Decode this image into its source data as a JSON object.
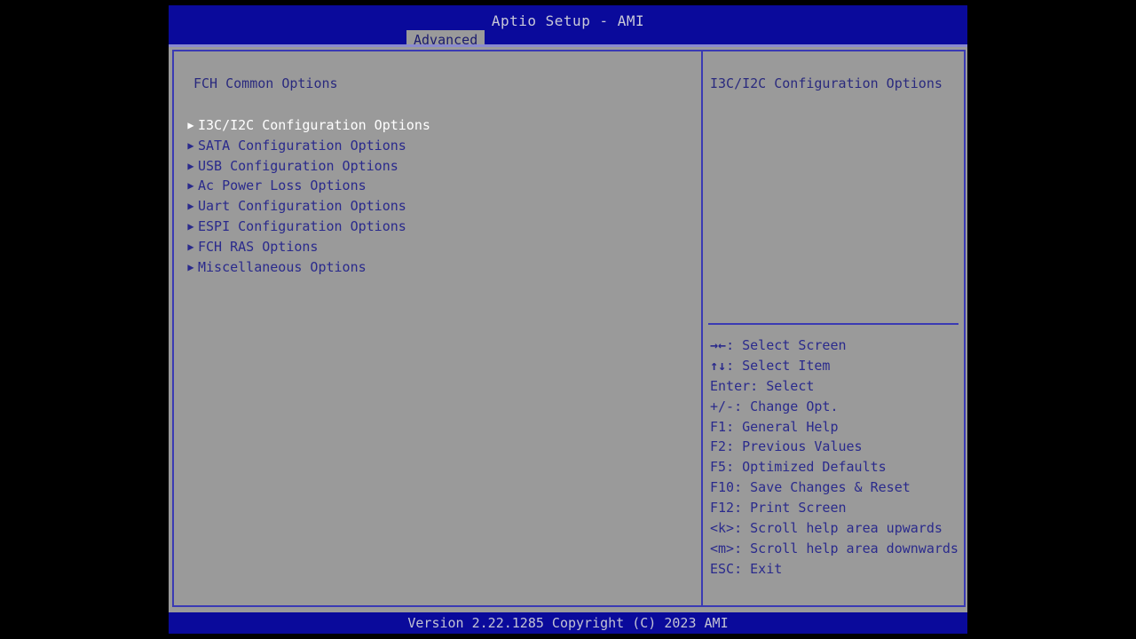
{
  "window": {
    "title": "Aptio Setup - AMI",
    "version_bar": "Version 2.22.1285 Copyright (C) 2023 AMI"
  },
  "tabs": [
    {
      "label": "Advanced",
      "active": true
    }
  ],
  "left_panel": {
    "section_title": "FCH Common Options",
    "menu_items": [
      {
        "label": "I3C/I2C Configuration Options",
        "arrow": "▶",
        "selected": true
      },
      {
        "label": "SATA Configuration Options",
        "arrow": "▶",
        "selected": false
      },
      {
        "label": "USB Configuration Options",
        "arrow": "▶",
        "selected": false
      },
      {
        "label": "Ac Power Loss Options",
        "arrow": "▶",
        "selected": false
      },
      {
        "label": "Uart Configuration Options",
        "arrow": "▶",
        "selected": false
      },
      {
        "label": "ESPI Configuration Options",
        "arrow": "▶",
        "selected": false
      },
      {
        "label": "FCH RAS Options",
        "arrow": "▶",
        "selected": false
      },
      {
        "label": "Miscellaneous Options",
        "arrow": "▶",
        "selected": false
      }
    ]
  },
  "right_panel": {
    "help_text": "I3C/I2C Configuration Options",
    "key_legend": [
      {
        "glyph": "→←",
        "key": "",
        "action": ": Select Screen"
      },
      {
        "glyph": "↑↓",
        "key": "",
        "action": ": Select Item"
      },
      {
        "glyph": "",
        "key": "Enter",
        "action": ": Select"
      },
      {
        "glyph": "",
        "key": "+/-",
        "action": ": Change Opt."
      },
      {
        "glyph": "",
        "key": "F1",
        "action": ": General Help"
      },
      {
        "glyph": "",
        "key": "F2",
        "action": ": Previous Values"
      },
      {
        "glyph": "",
        "key": "F5",
        "action": ": Optimized Defaults"
      },
      {
        "glyph": "",
        "key": "F10",
        "action": ": Save Changes & Reset"
      },
      {
        "glyph": "",
        "key": "F12",
        "action": ": Print Screen"
      },
      {
        "glyph": "",
        "key": "<k>",
        "action": ": Scroll help area upwards"
      },
      {
        "glyph": "",
        "key": "<m>",
        "action": ": Scroll help area downwards"
      },
      {
        "glyph": "",
        "key": "ESC",
        "action": ": Exit"
      }
    ]
  },
  "colors": {
    "header_blue": "#0a0a9b",
    "panel_gray": "#9a9a9a",
    "border_blue": "#3a3ab4",
    "text_blue": "#2a2a8c",
    "selected_text": "#ffffff",
    "title_text": "#c9c9d8",
    "backdrop": "#000000"
  }
}
